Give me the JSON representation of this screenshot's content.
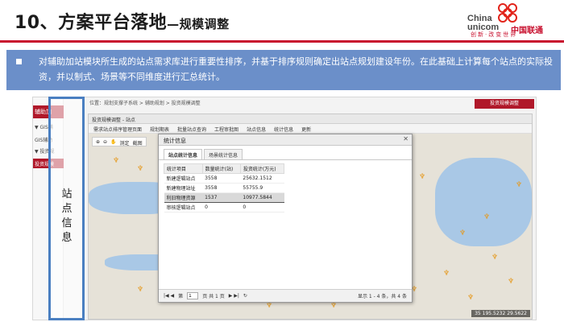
{
  "header": {
    "title_main": "10、方案平台落地",
    "title_sub": "—规模调整"
  },
  "logo": {
    "en_top": "China",
    "en_bottom": "unicom",
    "cn": "中国联通",
    "slogan": "创新·改变世界",
    "color": "#e2231a"
  },
  "description": {
    "text": "对辅助加站模块所生成的站点需求库进行重要性排序，并基于排序规则确定出站点规划建设年份。在此基础上计算每个站点的实际投资，并以制式、场景等不同维度进行汇总统计。",
    "bar_color": "#6b8fc9"
  },
  "screenshot": {
    "nav_head": "辅助加",
    "nav_items": [
      "▼ GIS辅",
      "GIS辅助",
      "▼ 投资规"
    ],
    "nav_selected": "投资规模",
    "breadcrumb": "位置：规划支撑子系统 > 辅助规划 > 投资规模调整",
    "tool_button": "投资规模调整",
    "app_title": "投资规模调整 - 站点",
    "menu": [
      "需求站点排序管理页面",
      "规划期表",
      "批量站点查询",
      "工程审批图",
      "站点信息",
      "统计信息",
      "更新"
    ],
    "map_tools": [
      "⊕",
      "⊖",
      "✋",
      "测定",
      "截图"
    ],
    "coords": "35   195.5232  29.5622",
    "frame_label": "站点信息"
  },
  "dialog": {
    "title": "统计信息",
    "close": "✕",
    "tabs": [
      "站点统计信息",
      "场景统计信息"
    ],
    "columns": [
      "统计项目",
      "数量统计(站)",
      "投资统计(万元)"
    ],
    "rows": [
      [
        "新建逻辑站点",
        "3558",
        "25632.1512"
      ],
      [
        "新建物理站址",
        "3558",
        "55755.9"
      ],
      [
        "利旧物理资源",
        "1537",
        "10977.5844"
      ],
      [
        "审核逻辑站点",
        "0",
        "0"
      ]
    ],
    "selected_row": 2,
    "pager": {
      "nav": "|◀ ◀",
      "page_label": "第",
      "page_value": "1",
      "page_total": "页 共 1 页",
      "nav_next": "▶ ▶|",
      "refresh": "↻",
      "info": "显示 1 - 4 条，共 4 条"
    }
  }
}
